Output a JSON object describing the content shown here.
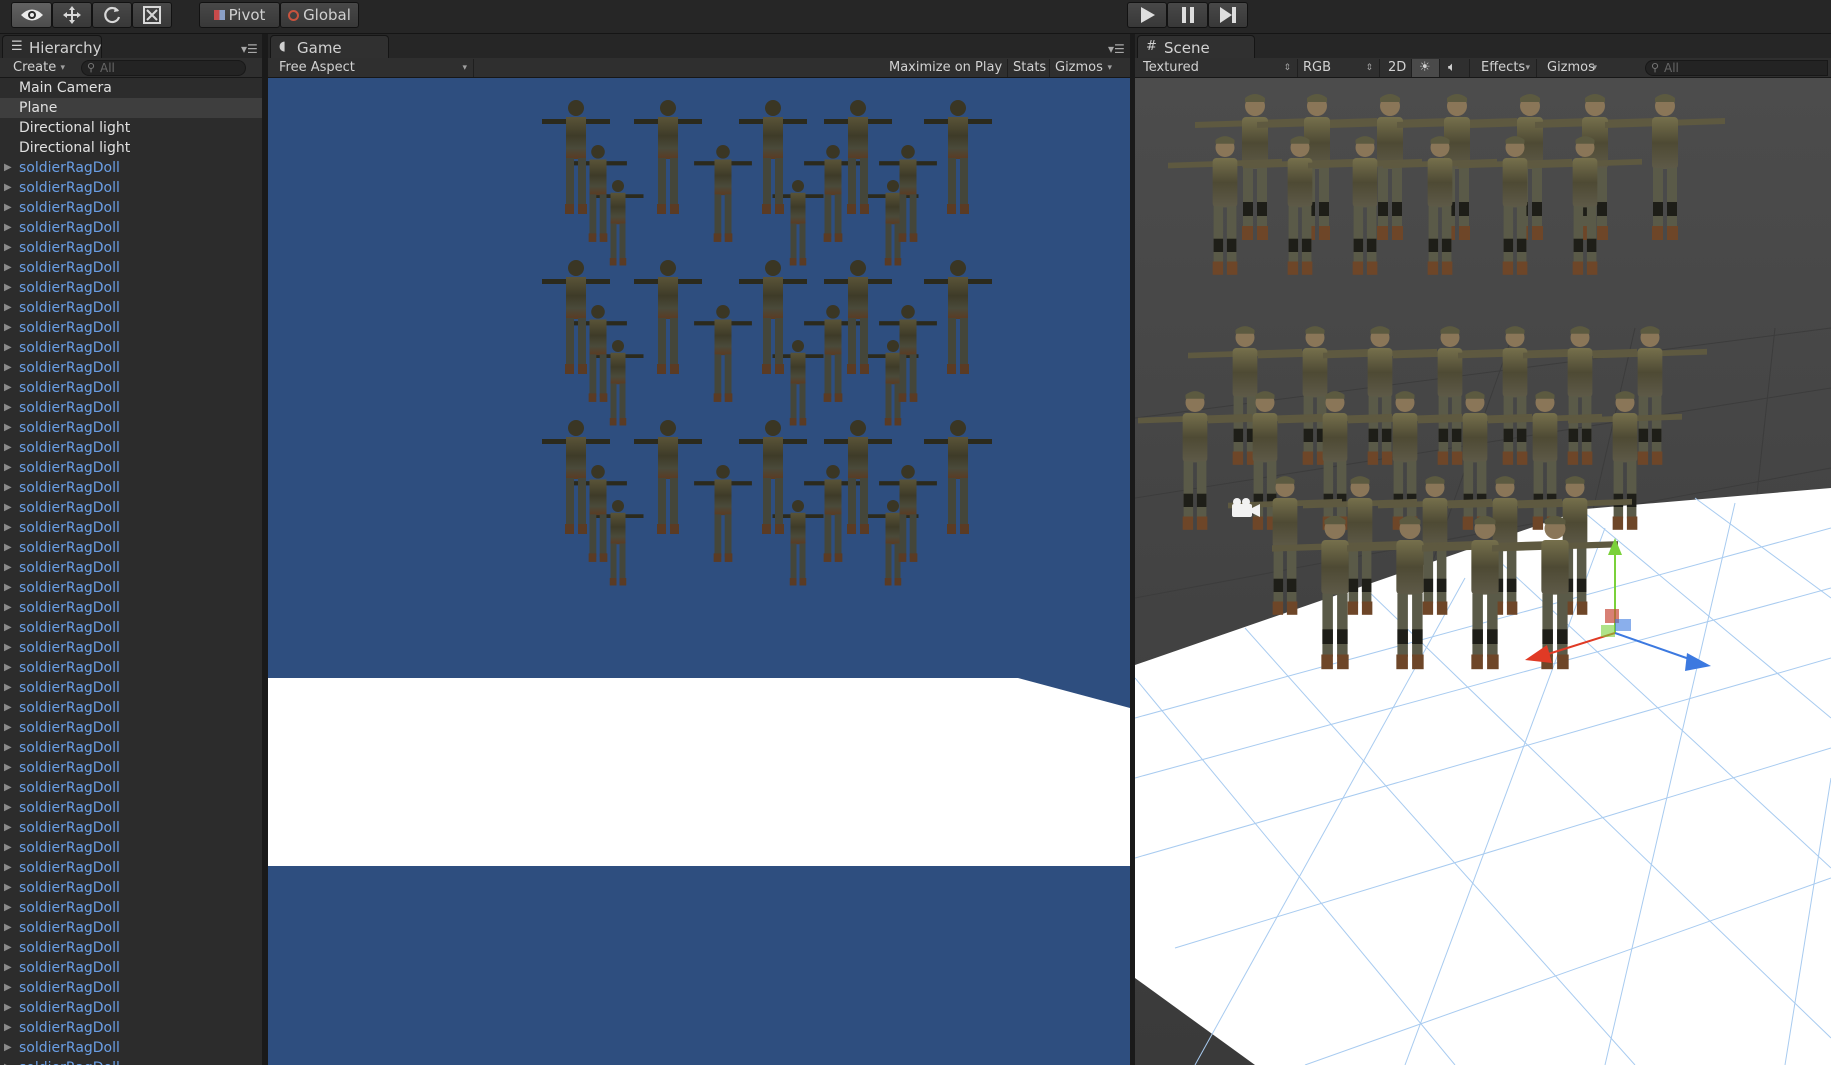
{
  "toolbar": {
    "tools": [
      "view-tool",
      "move-tool",
      "rotate-tool",
      "scale-tool"
    ],
    "pivot_label": "Pivot",
    "global_label": "Global",
    "play_controls": [
      "play",
      "pause",
      "step"
    ]
  },
  "hierarchy": {
    "tab_label": "Hierarchy",
    "create_label": "Create",
    "search_placeholder": "All",
    "items": [
      {
        "label": "Main Camera",
        "type": "object"
      },
      {
        "label": "Plane",
        "type": "object",
        "selected": true
      },
      {
        "label": "Directional light",
        "type": "object"
      },
      {
        "label": "Directional light",
        "type": "object"
      },
      {
        "label": "soldierRagDoll",
        "type": "prefab"
      },
      {
        "label": "soldierRagDoll",
        "type": "prefab"
      },
      {
        "label": "soldierRagDoll",
        "type": "prefab"
      },
      {
        "label": "soldierRagDoll",
        "type": "prefab"
      },
      {
        "label": "soldierRagDoll",
        "type": "prefab"
      },
      {
        "label": "soldierRagDoll",
        "type": "prefab"
      },
      {
        "label": "soldierRagDoll",
        "type": "prefab"
      },
      {
        "label": "soldierRagDoll",
        "type": "prefab"
      },
      {
        "label": "soldierRagDoll",
        "type": "prefab"
      },
      {
        "label": "soldierRagDoll",
        "type": "prefab"
      },
      {
        "label": "soldierRagDoll",
        "type": "prefab"
      },
      {
        "label": "soldierRagDoll",
        "type": "prefab"
      },
      {
        "label": "soldierRagDoll",
        "type": "prefab"
      },
      {
        "label": "soldierRagDoll",
        "type": "prefab"
      },
      {
        "label": "soldierRagDoll",
        "type": "prefab"
      },
      {
        "label": "soldierRagDoll",
        "type": "prefab"
      },
      {
        "label": "soldierRagDoll",
        "type": "prefab"
      },
      {
        "label": "soldierRagDoll",
        "type": "prefab"
      },
      {
        "label": "soldierRagDoll",
        "type": "prefab"
      },
      {
        "label": "soldierRagDoll",
        "type": "prefab"
      },
      {
        "label": "soldierRagDoll",
        "type": "prefab"
      },
      {
        "label": "soldierRagDoll",
        "type": "prefab"
      },
      {
        "label": "soldierRagDoll",
        "type": "prefab"
      },
      {
        "label": "soldierRagDoll",
        "type": "prefab"
      },
      {
        "label": "soldierRagDoll",
        "type": "prefab"
      },
      {
        "label": "soldierRagDoll",
        "type": "prefab"
      },
      {
        "label": "soldierRagDoll",
        "type": "prefab"
      },
      {
        "label": "soldierRagDoll",
        "type": "prefab"
      },
      {
        "label": "soldierRagDoll",
        "type": "prefab"
      },
      {
        "label": "soldierRagDoll",
        "type": "prefab"
      },
      {
        "label": "soldierRagDoll",
        "type": "prefab"
      },
      {
        "label": "soldierRagDoll",
        "type": "prefab"
      },
      {
        "label": "soldierRagDoll",
        "type": "prefab"
      },
      {
        "label": "soldierRagDoll",
        "type": "prefab"
      },
      {
        "label": "soldierRagDoll",
        "type": "prefab"
      },
      {
        "label": "soldierRagDoll",
        "type": "prefab"
      },
      {
        "label": "soldierRagDoll",
        "type": "prefab"
      },
      {
        "label": "soldierRagDoll",
        "type": "prefab"
      },
      {
        "label": "soldierRagDoll",
        "type": "prefab"
      },
      {
        "label": "soldierRagDoll",
        "type": "prefab"
      },
      {
        "label": "soldierRagDoll",
        "type": "prefab"
      },
      {
        "label": "soldierRagDoll",
        "type": "prefab"
      },
      {
        "label": "soldierRagDoll",
        "type": "prefab"
      },
      {
        "label": "soldierRagDoll",
        "type": "prefab"
      },
      {
        "label": "soldierRagDoll",
        "type": "prefab"
      },
      {
        "label": "soldierRagDoll",
        "type": "prefab"
      }
    ]
  },
  "game": {
    "tab_label": "Game",
    "aspect_label": "Free Aspect",
    "maximize_label": "Maximize on Play",
    "stats_label": "Stats",
    "gizmos_label": "Gizmos",
    "colors": {
      "sky": "#2e4e7f",
      "plane": "#ffffff"
    }
  },
  "scene": {
    "tab_label": "Scene",
    "shading_label": "Textured",
    "render_mode_label": "RGB",
    "mode_2d_label": "2D",
    "effects_label": "Effects",
    "gizmos_label": "Gizmos",
    "search_placeholder": "All",
    "colors": {
      "background": "#454545",
      "plane": "#ffffff",
      "grid": "#9cc4ef"
    }
  }
}
